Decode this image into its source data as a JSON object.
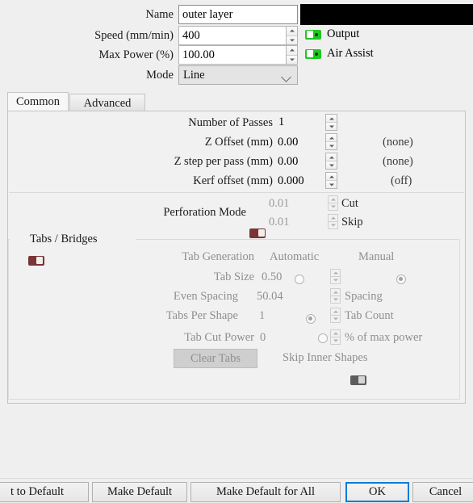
{
  "window": {
    "layer_color": "#000000"
  },
  "top_form": {
    "name_label": "Name",
    "name_value": "outer layer",
    "speed_label": "Speed (mm/min)",
    "speed_value": "400",
    "max_power_label": "Max Power (%)",
    "max_power_value": "100.00",
    "mode_label": "Mode",
    "mode_value": "Line",
    "output_label": "Output",
    "output_state": "on",
    "air_assist_label": "Air Assist",
    "air_assist_state": "on"
  },
  "tabs": [
    {
      "label": "Common",
      "selected": true
    },
    {
      "label": "Advanced",
      "selected": false
    }
  ],
  "common": {
    "rows": [
      {
        "label": "Number of Passes",
        "value": "1",
        "suffix": ""
      },
      {
        "label": "Z Offset (mm)",
        "value": "0.00",
        "suffix": "(none)"
      },
      {
        "label": "Z step per pass (mm)",
        "value": "0.00",
        "suffix": "(none)"
      },
      {
        "label": "Kerf offset (mm)",
        "value": "0.000",
        "suffix": "(off)"
      }
    ],
    "perforation": {
      "label": "Perforation Mode",
      "state": "off",
      "cut_value": "0.01",
      "cut_label": "Cut",
      "skip_value": "0.01",
      "skip_label": "Skip"
    },
    "tabs_bridges": {
      "group_label": "Tabs / Bridges",
      "group_state": "off",
      "tab_generation_label": "Tab Generation",
      "automatic_label": "Automatic",
      "automatic_checked": false,
      "manual_label": "Manual",
      "manual_checked": true,
      "tab_size_label": "Tab Size",
      "tab_size_value": "0.50",
      "even_spacing_label": "Even Spacing",
      "even_spacing_checked": true,
      "even_spacing_value": "50.04",
      "spacing_label": "Spacing",
      "tabs_per_shape_label": "Tabs Per Shape",
      "tabs_per_shape_checked": false,
      "tabs_per_shape_value": "1",
      "tab_count_label": "Tab Count",
      "tab_cut_power_label": "Tab Cut Power",
      "tab_cut_power_value": "0",
      "percent_max_power_label": "% of max power",
      "clear_tabs_label": "Clear Tabs",
      "skip_inner_shapes_label": "Skip Inner Shapes",
      "skip_inner_shapes_state": "off"
    }
  },
  "footer": {
    "reset_to_default_label": "t to Default",
    "make_default_label": "Make Default",
    "make_default_for_all_label": "Make Default for All",
    "ok_label": "OK",
    "cancel_label": "Cancel"
  }
}
